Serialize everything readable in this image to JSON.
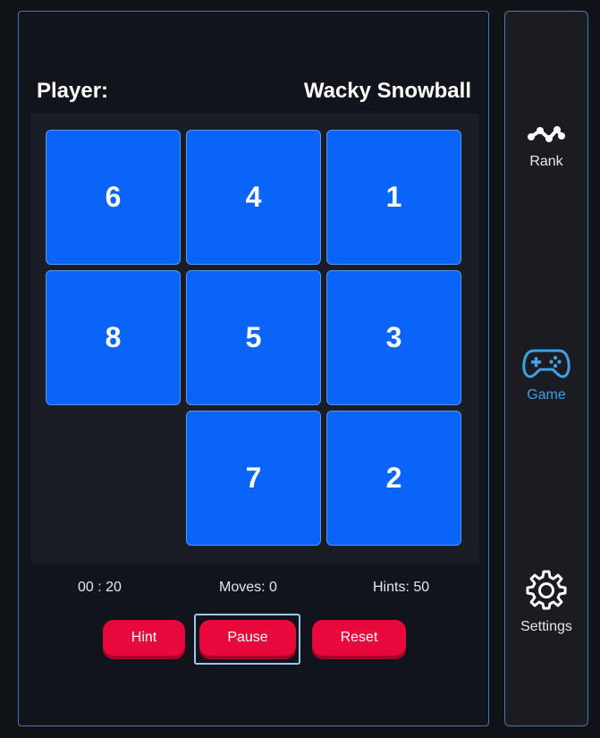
{
  "player": {
    "label": "Player:",
    "name": "Wacky Snowball"
  },
  "board": {
    "tiles": [
      "6",
      "4",
      "1",
      "8",
      "5",
      "3",
      "",
      "7",
      "2"
    ],
    "tile_color": "#0a64f9",
    "empty_index": 6
  },
  "stats": {
    "timer": "00 : 20",
    "moves": "Moves: 0",
    "hints": "Hints: 50"
  },
  "buttons": {
    "hint": "Hint",
    "pause": "Pause",
    "reset": "Reset",
    "color": "#e8083b",
    "focused": "pause"
  },
  "nav": {
    "items": [
      {
        "label": "Rank",
        "icon": "rank-icon"
      },
      {
        "label": "Game",
        "icon": "gamepad-icon",
        "active": true
      },
      {
        "label": "Settings",
        "icon": "gear-icon"
      }
    ],
    "active_color": "#3fa0e8"
  }
}
